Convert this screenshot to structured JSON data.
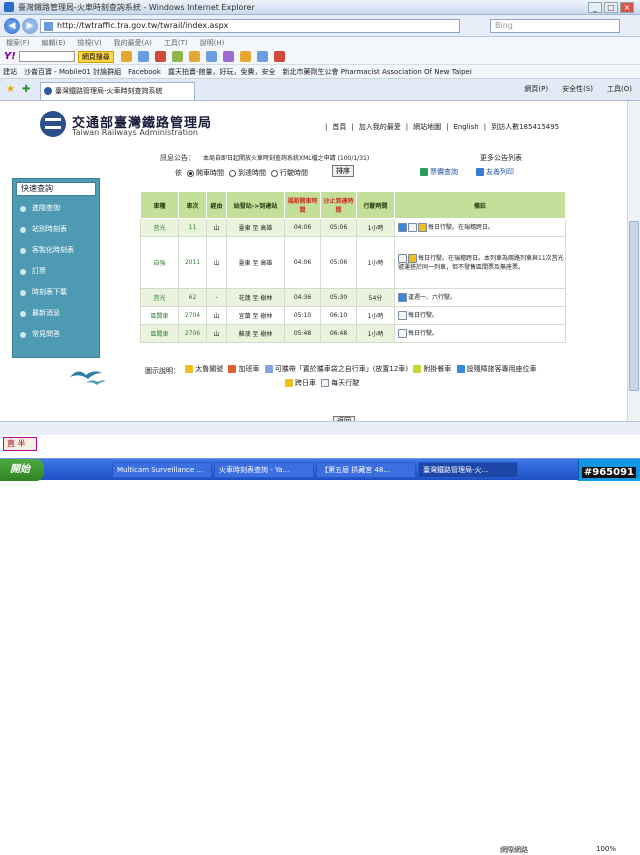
{
  "window": {
    "title": "臺灣鐵路管理局-火車時刻查詢系統 - Windows Internet Explorer"
  },
  "address": {
    "url": "http://twtraffic.tra.gov.tw/twrail/index.aspx",
    "search_placeholder": "Bing"
  },
  "menu": [
    "檔案(F)",
    "編輯(E)",
    "檢視(V)",
    "我的最愛(A)",
    "工具(T)",
    "說明(H)"
  ],
  "toolbar": {
    "yahoo": "Y!",
    "search_btn": "網頁搜尋"
  },
  "favorites": [
    "建站",
    "沙崙百寶 - Mobile01 討論群組",
    "Facebook",
    "露天拍賣-館量，好玩，免費，安全",
    "新北市藥劑生公會 Pharmacist Association Of New Taipei"
  ],
  "tab": {
    "label": "臺灣鐵路管理局-火車時刻查詢系統"
  },
  "cmd": [
    "網頁(P)",
    "安全性(S)",
    "工具(O)"
  ],
  "site": {
    "title": "交通部臺灣鐵路管理局",
    "subtitle": "Taiwan Railways Administration",
    "topnav": [
      "首頁",
      "加入我的最愛",
      "網站地圖",
      "English",
      "到訪人數185415495"
    ]
  },
  "notice": {
    "label": "訊息公告：",
    "text": "本局自即日起開放火車時刻查詢系統XML檔之申請 (100/1/31)",
    "more": "更多公告列表"
  },
  "sort": {
    "label": "依",
    "options": [
      "開車時間",
      "到達時間",
      "行駛時間"
    ],
    "selected": 0,
    "button": "排序"
  },
  "links": {
    "fare": "票價查詢",
    "print": "友善列印"
  },
  "sidebar": {
    "head": "快速查詢",
    "items": [
      "進階查詢",
      "站別時刻表",
      "客製化時刻表",
      "訂票",
      "時刻表下載",
      "最新消息",
      "常見問答"
    ]
  },
  "table": {
    "headers": [
      "車種",
      "車次",
      "經由",
      "始發站->到達站",
      "福斯開車時間",
      "沙止到達時間",
      "行駛時間",
      "備註"
    ],
    "rows": [
      {
        "type": "莒光",
        "no": "11",
        "via": "山",
        "route": "臺東 至 高雄",
        "dep": "04:06",
        "arr": "05:06",
        "dur": "1小時",
        "note": "每日行駛。在瑞穗跨日。"
      },
      {
        "type": "自強",
        "no": "2011",
        "via": "山",
        "route": "臺東 至 高雄",
        "dep": "04:06",
        "arr": "05:06",
        "dur": "1小時",
        "note": "每日行駛。在瑞穗跨日。本列車為兩路列車與11次莒光號運搭於同一列車，但不發售區間票及無座票。"
      },
      {
        "type": "莒光",
        "no": "62",
        "via": "-",
        "route": "花蓮 至 樹林",
        "dep": "04:36",
        "arr": "05:30",
        "dur": "54分",
        "note": "逢週一、六行駛。"
      },
      {
        "type": "區間車",
        "no": "2704",
        "via": "山",
        "route": "宜蘭 至 樹林",
        "dep": "05:10",
        "arr": "06:10",
        "dur": "1小時",
        "note": "每日行駛。"
      },
      {
        "type": "區間車",
        "no": "2706",
        "via": "山",
        "route": "蘇澳 至 樹林",
        "dep": "05:48",
        "arr": "06:48",
        "dur": "1小時",
        "note": "每日行駛。"
      }
    ]
  },
  "legend": {
    "label": "圖示說明：",
    "items": [
      "太魯閣號",
      "加班車",
      "可攜帶「置於攜車袋之自行車」(放置12車)",
      "附掛餐車",
      "設殘障旅客專用座位車",
      "跨日車",
      "每天行駛"
    ]
  },
  "back": "返回",
  "status": {
    "zone": "網際網路",
    "zoom": "100%"
  },
  "ime": "直 半",
  "taskbar": {
    "start": "開始",
    "tasks": [
      "Multicam Surveillance ...",
      "火車時刻表查詢 - Ya...",
      "【第五屆 拱藏宮 48...",
      "臺灣鐵路管理局-火..."
    ]
  },
  "badge": "#965091"
}
